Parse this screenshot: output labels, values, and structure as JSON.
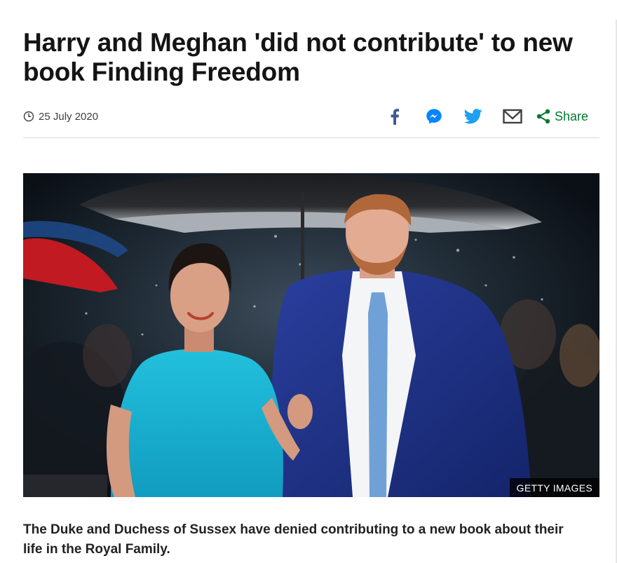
{
  "article": {
    "headline": "Harry and Meghan 'did not contribute' to new book Finding Freedom",
    "date": "25 July 2020",
    "share_label": "Share",
    "image_credit": "GETTY IMAGES",
    "intro": "The Duke and Duchess of Sussex have denied contributing to a new book about their life in the Royal Family."
  },
  "share_tools": [
    {
      "icon": "facebook-icon",
      "color": "#3b5998"
    },
    {
      "icon": "messenger-icon",
      "color": "#0084ff"
    },
    {
      "icon": "twitter-icon",
      "color": "#1da1f2"
    },
    {
      "icon": "email-icon",
      "color": "#404040"
    }
  ],
  "colors": {
    "share_green": "#007a2f",
    "headline": "#141414",
    "divider": "#dcdcdc"
  }
}
